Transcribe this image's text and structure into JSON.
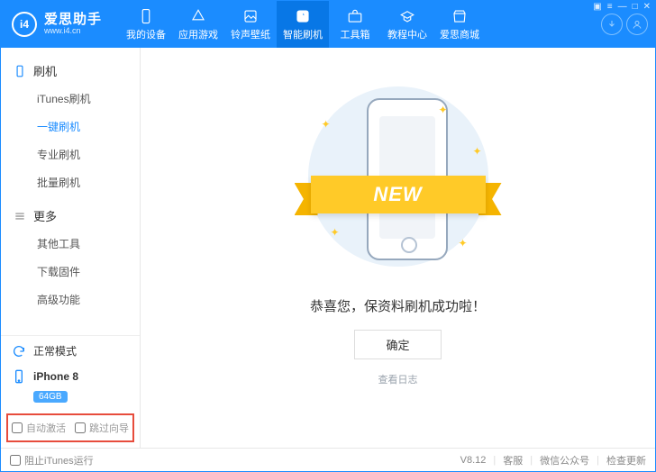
{
  "app": {
    "brand": "爱思助手",
    "url": "www.i4.cn",
    "logo_char": "i4"
  },
  "window_controls": [
    "⇧",
    "≡",
    "—",
    "□",
    "✕"
  ],
  "tabs": [
    {
      "label": "我的设备"
    },
    {
      "label": "应用游戏"
    },
    {
      "label": "铃声壁纸"
    },
    {
      "label": "智能刷机"
    },
    {
      "label": "工具箱"
    },
    {
      "label": "教程中心"
    },
    {
      "label": "爱思商城"
    }
  ],
  "sidebar": {
    "section1_title": "刷机",
    "section1_items": [
      "iTunes刷机",
      "一键刷机",
      "专业刷机",
      "批量刷机"
    ],
    "section2_title": "更多",
    "section2_items": [
      "其他工具",
      "下载固件",
      "高级功能"
    ],
    "mode_label": "正常模式",
    "device_name": "iPhone 8",
    "device_capacity": "64GB",
    "opt_auto_activate": "自动激活",
    "opt_skip_wizard": "跳过向导"
  },
  "main": {
    "ribbon_text": "NEW",
    "success_msg": "恭喜您，保资料刷机成功啦！",
    "ok_label": "确定",
    "view_log": "查看日志"
  },
  "footer": {
    "block_itunes": "阻止iTunes运行",
    "version": "V8.12",
    "kefu": "客服",
    "wechat": "微信公众号",
    "check_update": "检查更新"
  }
}
